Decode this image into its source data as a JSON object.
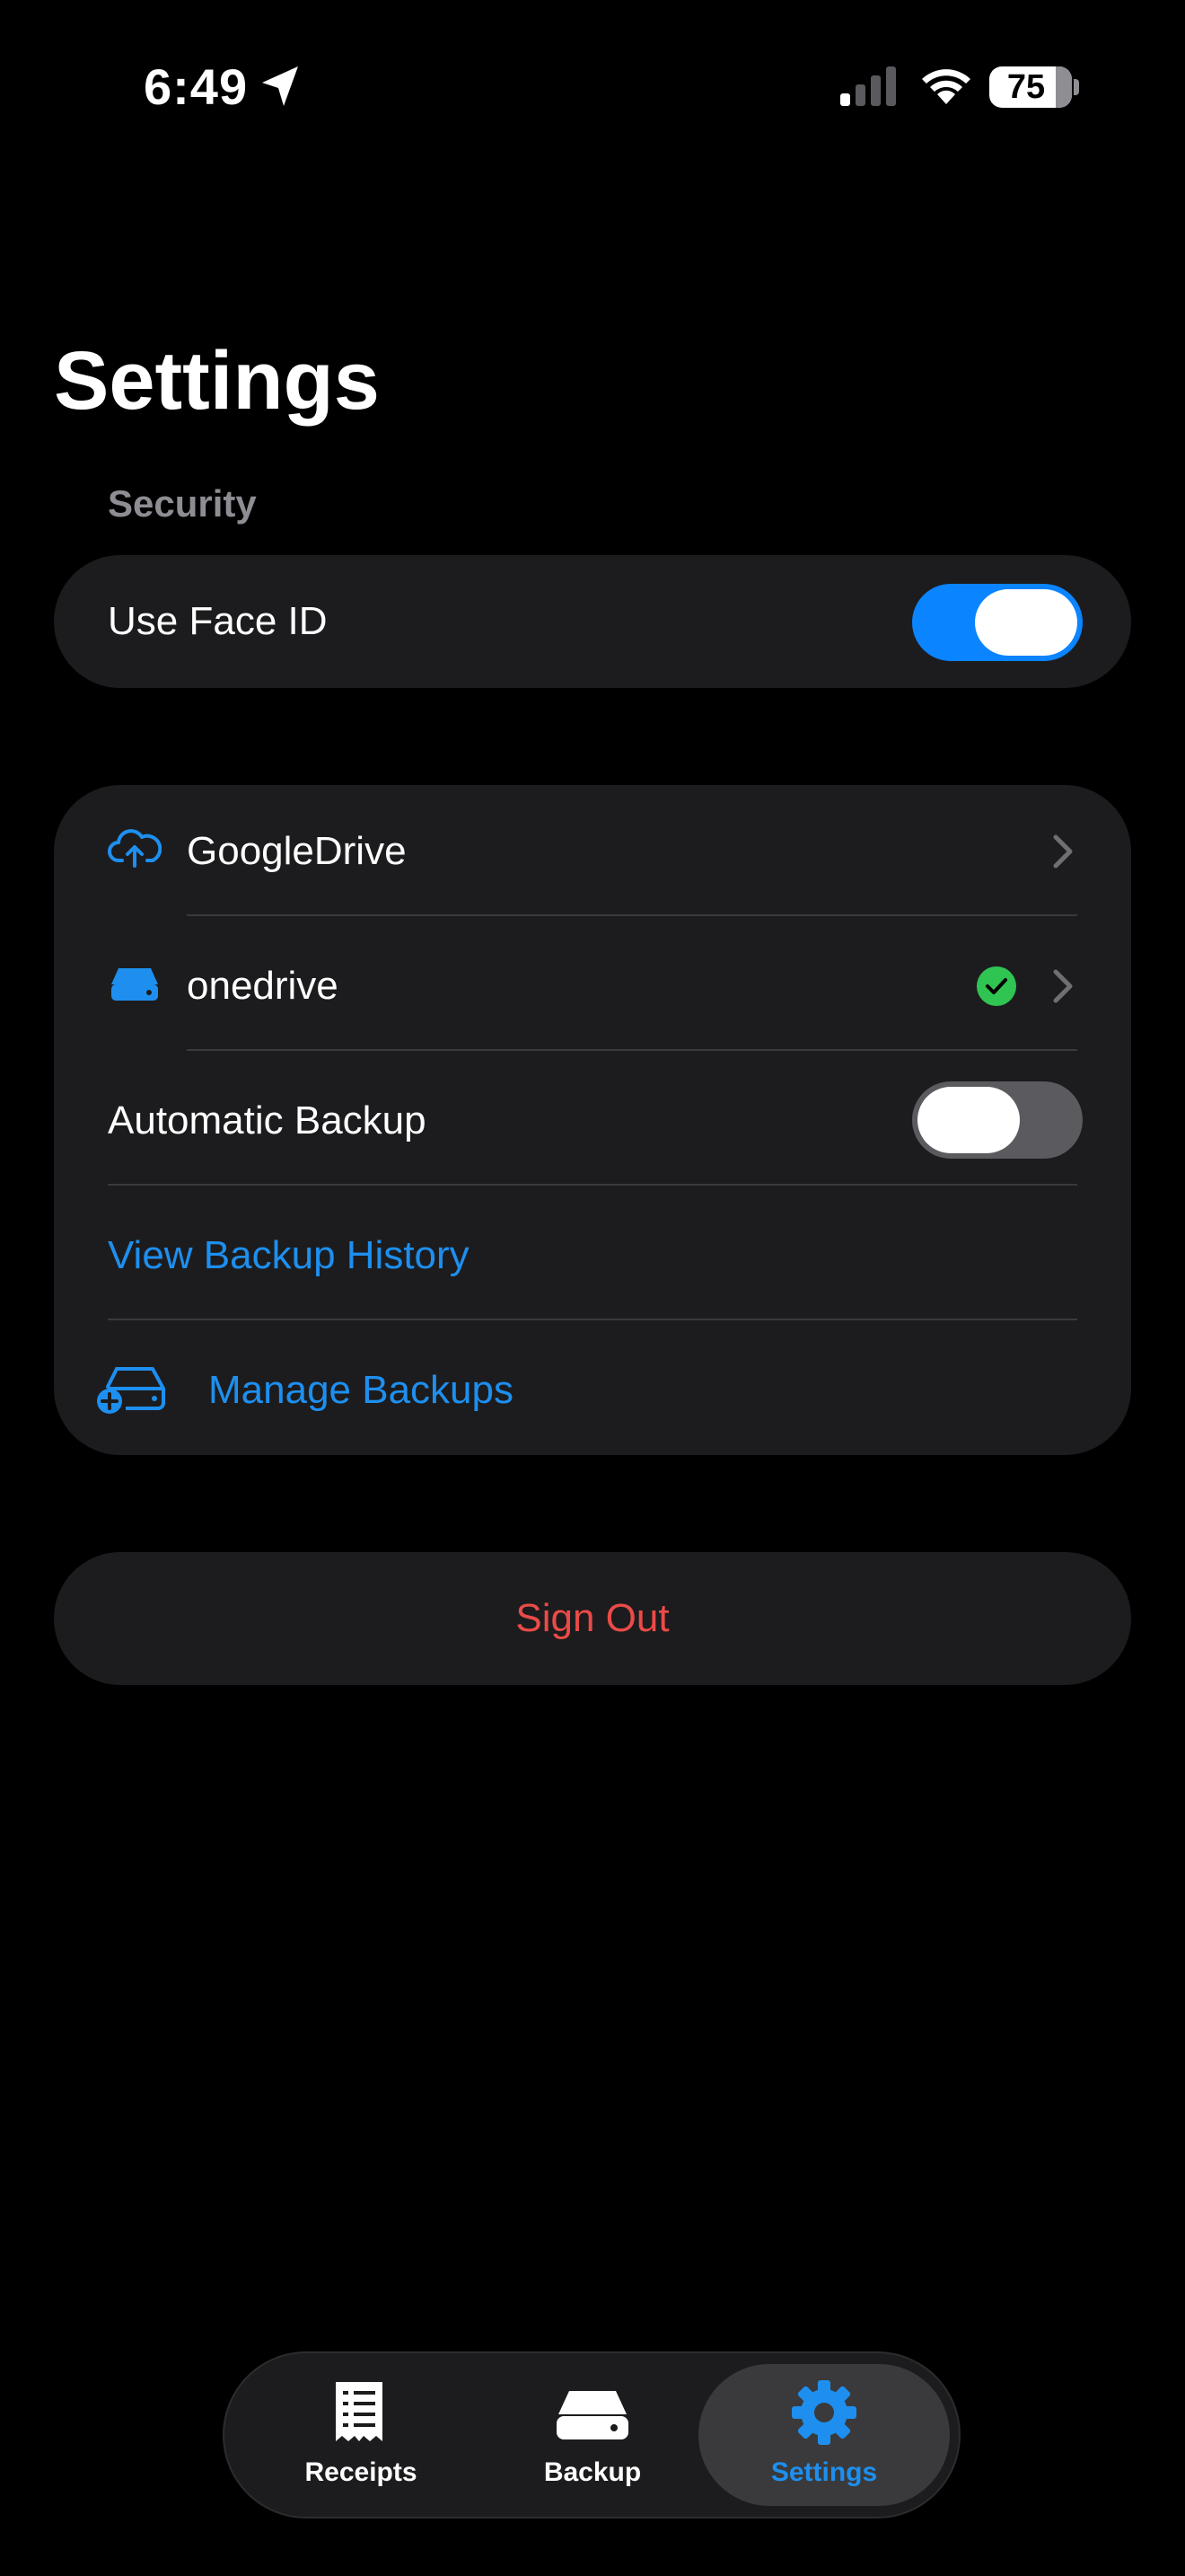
{
  "status_bar": {
    "time": "6:49",
    "battery": "75",
    "location_icon": "location-arrow-icon",
    "signal_icon": "cellular-signal-icon",
    "wifi_icon": "wifi-icon"
  },
  "page": {
    "title": "Settings"
  },
  "security": {
    "section_label": "Security",
    "face_id": {
      "label": "Use Face ID",
      "enabled": true
    }
  },
  "backup": {
    "google_drive": {
      "label": "GoogleDrive",
      "icon": "cloud-upload-icon"
    },
    "onedrive": {
      "label": "onedrive",
      "icon": "drive-icon",
      "connected": true
    },
    "automatic_backup": {
      "label": "Automatic Backup",
      "enabled": false
    },
    "view_history": {
      "label": "View Backup History"
    },
    "manage": {
      "label": "Manage Backups",
      "icon": "drive-add-icon"
    }
  },
  "sign_out": {
    "label": "Sign Out"
  },
  "tab_bar": {
    "tabs": [
      {
        "label": "Receipts",
        "icon": "receipt-icon",
        "active": false
      },
      {
        "label": "Backup",
        "icon": "drive-icon",
        "active": false
      },
      {
        "label": "Settings",
        "icon": "gear-icon",
        "active": true
      }
    ]
  },
  "colors": {
    "accent": "#0a84ff",
    "link": "#1e8fef",
    "destructive": "#eb4b47",
    "success": "#30c452",
    "card": "#1c1c1e",
    "background": "#000000"
  }
}
